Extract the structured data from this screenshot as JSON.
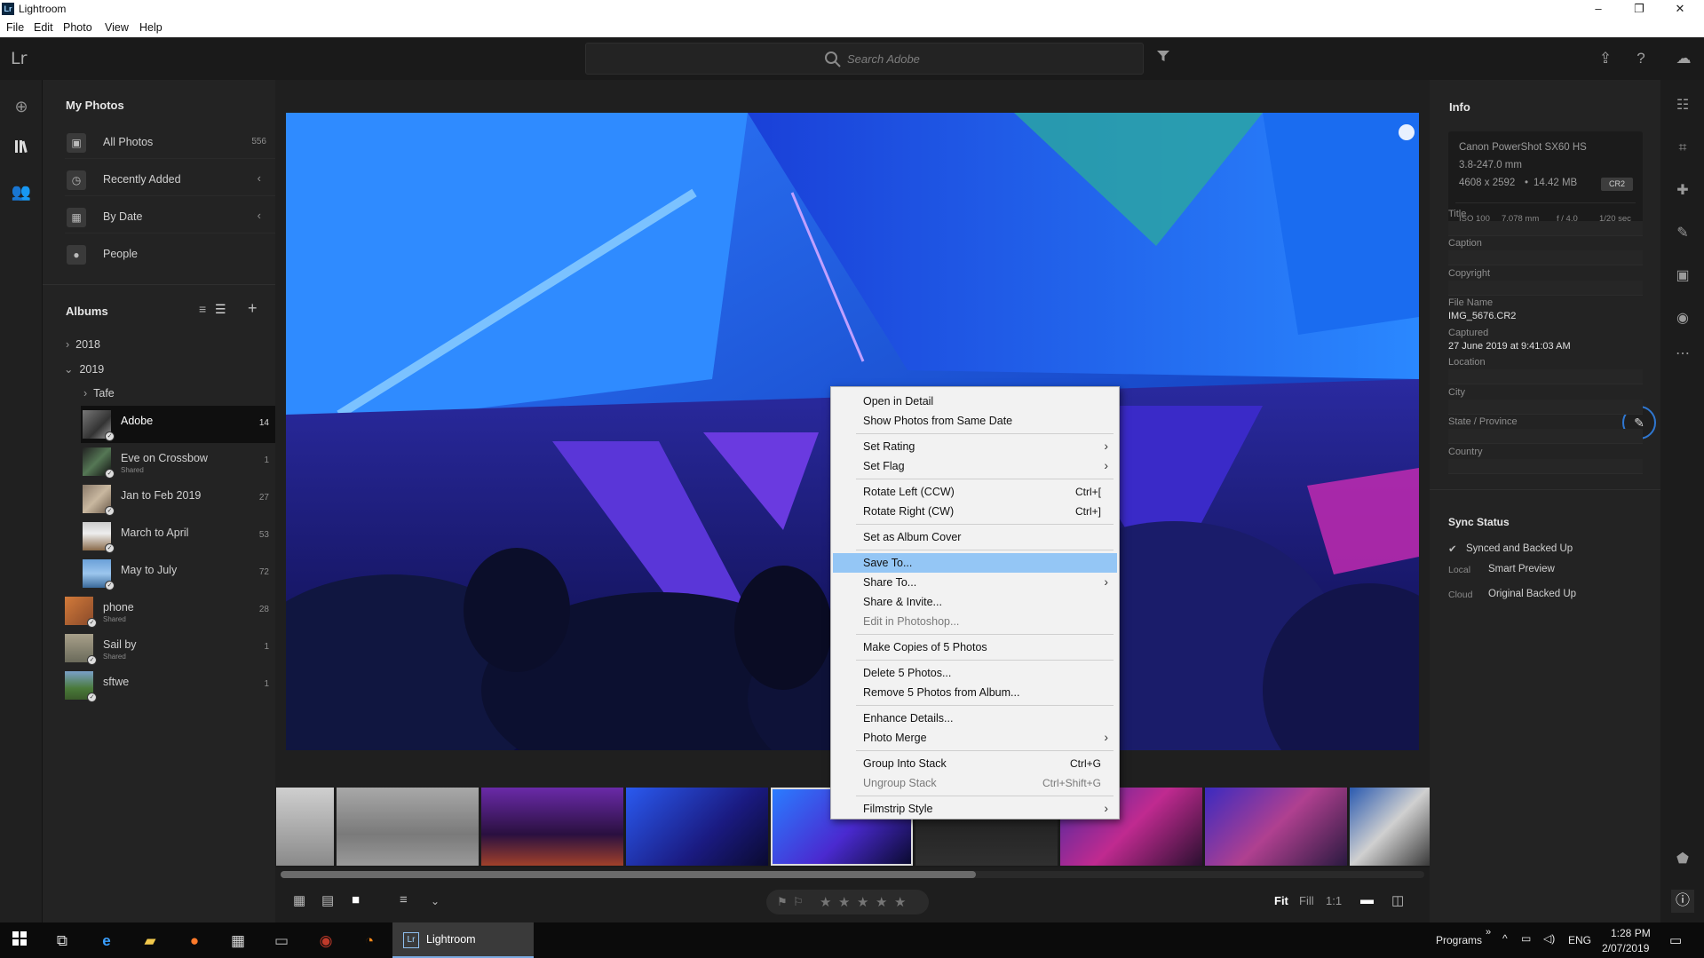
{
  "window": {
    "title": "Lightroom",
    "min": "–",
    "max": "❐",
    "close": "✕"
  },
  "menu": [
    "File",
    "Edit",
    "Photo",
    "View",
    "Help"
  ],
  "topbar": {
    "logo": "Lr",
    "search_placeholder": "Search Adobe"
  },
  "left": {
    "my_photos_title": "My Photos",
    "my_photos": [
      {
        "label": "All Photos",
        "count": "556"
      },
      {
        "label": "Recently Added",
        "count": ""
      },
      {
        "label": "By Date",
        "count": ""
      },
      {
        "label": "People",
        "count": ""
      }
    ],
    "albums_title": "Albums",
    "years": [
      "2018",
      "2019"
    ],
    "folder": "Tafe",
    "albums": [
      {
        "name": "Adobe",
        "count": "14",
        "shared": ""
      },
      {
        "name": "Eve on Crossbow",
        "count": "1",
        "shared": "Shared"
      },
      {
        "name": "Jan to Feb 2019",
        "count": "27",
        "shared": ""
      },
      {
        "name": "March to April",
        "count": "53",
        "shared": ""
      },
      {
        "name": "May to July",
        "count": "72",
        "shared": ""
      },
      {
        "name": "phone",
        "count": "28",
        "shared": "Shared"
      },
      {
        "name": "Sail by",
        "count": "1",
        "shared": "Shared"
      },
      {
        "name": "sftwe",
        "count": "1",
        "shared": ""
      }
    ]
  },
  "context_menu": [
    {
      "label": "Open in Detail",
      "shortcut": "",
      "submenu": false,
      "disabled": false
    },
    {
      "label": "Show Photos from Same Date",
      "shortcut": "",
      "submenu": false,
      "disabled": false
    },
    {
      "label": "Set Rating",
      "shortcut": "",
      "submenu": true,
      "disabled": false
    },
    {
      "label": "Set Flag",
      "shortcut": "",
      "submenu": true,
      "disabled": false
    },
    {
      "label": "Rotate Left (CCW)",
      "shortcut": "Ctrl+[",
      "submenu": false,
      "disabled": false
    },
    {
      "label": "Rotate Right (CW)",
      "shortcut": "Ctrl+]",
      "submenu": false,
      "disabled": false
    },
    {
      "label": "Set as Album Cover",
      "shortcut": "",
      "submenu": false,
      "disabled": false
    },
    {
      "label": "Save To...",
      "shortcut": "",
      "submenu": false,
      "disabled": false,
      "highlighted": true
    },
    {
      "label": "Share To...",
      "shortcut": "",
      "submenu": true,
      "disabled": false
    },
    {
      "label": "Share & Invite...",
      "shortcut": "",
      "submenu": false,
      "disabled": false
    },
    {
      "label": "Edit in Photoshop...",
      "shortcut": "",
      "submenu": false,
      "disabled": true
    },
    {
      "label": "Make Copies of 5 Photos",
      "shortcut": "",
      "submenu": false,
      "disabled": false
    },
    {
      "label": "Delete 5 Photos...",
      "shortcut": "",
      "submenu": false,
      "disabled": false
    },
    {
      "label": "Remove 5 Photos from Album...",
      "shortcut": "",
      "submenu": false,
      "disabled": false
    },
    {
      "label": "Enhance Details...",
      "shortcut": "",
      "submenu": false,
      "disabled": false
    },
    {
      "label": "Photo Merge",
      "shortcut": "",
      "submenu": true,
      "disabled": false
    },
    {
      "label": "Group Into Stack",
      "shortcut": "Ctrl+G",
      "submenu": false,
      "disabled": false
    },
    {
      "label": "Ungroup Stack",
      "shortcut": "Ctrl+Shift+G",
      "submenu": false,
      "disabled": true
    },
    {
      "label": "Filmstrip Style",
      "shortcut": "",
      "submenu": true,
      "disabled": false
    }
  ],
  "info": {
    "title": "Info",
    "camera": "Canon PowerShot SX60 HS",
    "lens": "3.8-247.0 mm",
    "dimensions": "4608 x 2592",
    "size": "14.42 MB",
    "format": "CR2",
    "iso": "ISO 100",
    "focal": "7.078 mm",
    "aperture": "f / 4.0",
    "shutter": "1/20 sec",
    "fields": {
      "title_label": "Title",
      "caption_label": "Caption",
      "copyright_label": "Copyright",
      "filename_label": "File Name",
      "filename": "IMG_5676.CR2",
      "captured_label": "Captured",
      "captured": "27 June 2019 at 9:41:03 AM",
      "location_label": "Location",
      "city_label": "City",
      "state_label": "State / Province",
      "country_label": "Country"
    },
    "sync_title": "Sync Status",
    "sync_state": "Synced and Backed Up",
    "local_label": "Local",
    "local_value": "Smart Preview",
    "cloud_label": "Cloud",
    "cloud_value": "Original Backed Up"
  },
  "bottombar": {
    "fit": "Fit",
    "fill": "Fill",
    "one_to_one": "1:1"
  },
  "taskbar": {
    "app": "Lightroom",
    "programs": "Programs",
    "chevrons": "»",
    "lang": "ENG",
    "time": "1:28 PM",
    "date": "2/07/2019"
  },
  "colors": {
    "accent": "#2f77d1",
    "menu_highlight": "#94c6f5"
  }
}
